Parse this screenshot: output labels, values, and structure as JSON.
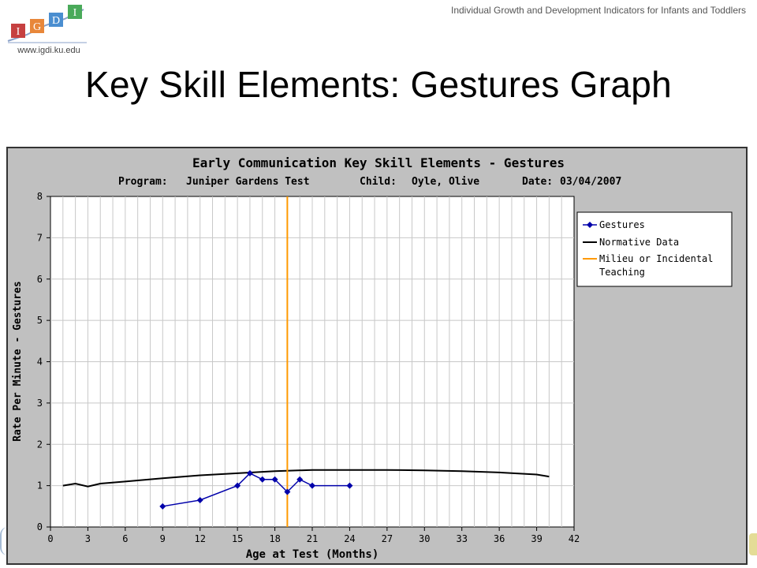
{
  "header": {
    "subtitle": "Individual Growth and Development Indicators for Infants and Toddlers",
    "logo_url": "www.igdi.ku.edu",
    "logo_letters": [
      "I",
      "G",
      "D",
      "I"
    ],
    "title": "Key Skill Elements: Gestures Graph"
  },
  "colors": {
    "plot_bg": "#ffffff",
    "outer_bg": "#c0c0c0",
    "grid": "#c8c8c8",
    "gestures": "#0000aa",
    "normative": "#000000",
    "teaching": "#ff9900",
    "logo": [
      "#e8873a",
      "#c64040",
      "#4a8ed0",
      "#4aaa5a"
    ]
  },
  "chart_data": {
    "type": "line",
    "title": "Early Communication Key Skill Elements - Gestures",
    "info": {
      "program_label": "Program:",
      "program": "Juniper Gardens Test",
      "child_label": "Child:",
      "child": "Oyle, Olive",
      "date_label": "Date:",
      "date": "03/04/2007"
    },
    "xlabel": "Age at Test (Months)",
    "ylabel": "Rate Per Minute - Gestures",
    "xlim": [
      0,
      42
    ],
    "ylim": [
      0,
      8
    ],
    "x_ticks": [
      "0",
      "3",
      "6",
      "9",
      "12",
      "15",
      "18",
      "21",
      "24",
      "27",
      "30",
      "33",
      "36",
      "39",
      "42"
    ],
    "y_ticks": [
      "0",
      "1",
      "2",
      "3",
      "4",
      "5",
      "6",
      "7",
      "8"
    ],
    "grid": true,
    "legend_position": "right",
    "series": [
      {
        "name": "Gestures",
        "kind": "line-markers",
        "x": [
          9,
          12,
          15,
          16,
          17,
          18,
          19,
          20,
          21,
          24
        ],
        "y": [
          0.5,
          0.65,
          1.0,
          1.3,
          1.15,
          1.15,
          0.85,
          1.15,
          1.0,
          1.0
        ]
      },
      {
        "name": "Normative Data",
        "kind": "line",
        "x": [
          1,
          2,
          3,
          4,
          6,
          9,
          12,
          15,
          18,
          21,
          24,
          27,
          30,
          33,
          36,
          39,
          40
        ],
        "y": [
          1.0,
          1.05,
          0.98,
          1.05,
          1.1,
          1.18,
          1.25,
          1.3,
          1.35,
          1.38,
          1.38,
          1.38,
          1.37,
          1.35,
          1.32,
          1.27,
          1.22
        ]
      },
      {
        "name": "Milieu or Incidental Teaching",
        "legend_lines": [
          "Milieu or Incidental",
          "Teaching"
        ],
        "kind": "vline",
        "x": [
          19
        ]
      }
    ]
  }
}
